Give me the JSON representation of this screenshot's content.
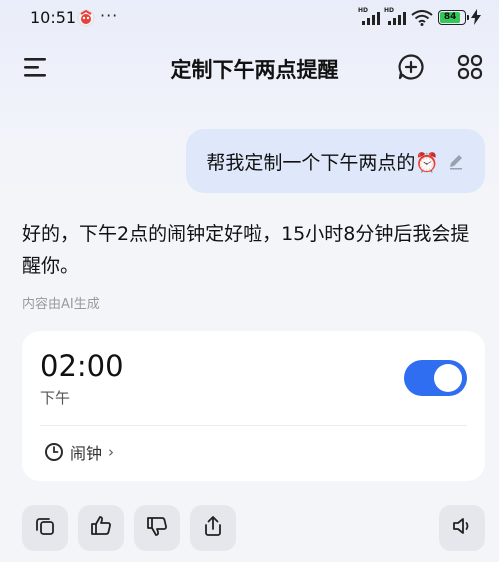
{
  "status_bar": {
    "time": "10:51",
    "more": "···",
    "signal_1_label": "HD",
    "signal_2_label": "HD",
    "battery_level": "84"
  },
  "header": {
    "title": "定制下午两点提醒"
  },
  "user_message": {
    "text": "帮我定制一个下午两点的⏰"
  },
  "ai_message": {
    "text": "好的，下午2点的闹钟定好啦，15小时8分钟后我会提醒你。",
    "disclaimer": "内容由AI生成"
  },
  "alarm_card": {
    "time": "02:00",
    "period": "下午",
    "enabled": true,
    "app_label": "闹钟",
    "app_chevron": "›"
  },
  "actions": {
    "icons": [
      "copy-icon",
      "thumbs-up-icon",
      "thumbs-down-icon",
      "share-icon",
      "speaker-icon"
    ]
  },
  "colors": {
    "accent": "#2f6ef0",
    "user_bubble": "#dfe8fa",
    "battery": "#34c759"
  }
}
